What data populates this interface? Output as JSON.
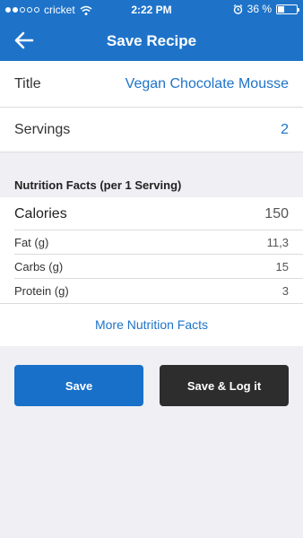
{
  "status_bar": {
    "carrier": "cricket",
    "time": "2:22 PM",
    "battery_percent": "36 %",
    "battery_level": 0.36,
    "icons": [
      "signal-dots-icon",
      "wifi-icon",
      "alarm-icon",
      "battery-icon"
    ]
  },
  "nav": {
    "title": "Save Recipe",
    "back_icon": "arrow-left-icon"
  },
  "recipe": {
    "title_label": "Title",
    "title_value": "Vegan Chocolate Mousse",
    "servings_label": "Servings",
    "servings_value": "2"
  },
  "nutrition": {
    "header": "Nutrition Facts (per 1 Serving)",
    "calories_label": "Calories",
    "calories_value": "150",
    "rows": [
      {
        "label": "Fat (g)",
        "value": "11,3"
      },
      {
        "label": "Carbs (g)",
        "value": "15"
      },
      {
        "label": "Protein (g)",
        "value": "3"
      }
    ],
    "more_link": "More Nutrition Facts"
  },
  "actions": {
    "save_label": "Save",
    "save_log_label": "Save & Log it"
  },
  "colors": {
    "accent": "#1e73c9",
    "dark_button": "#2d2d2d",
    "background": "#efeff4"
  }
}
